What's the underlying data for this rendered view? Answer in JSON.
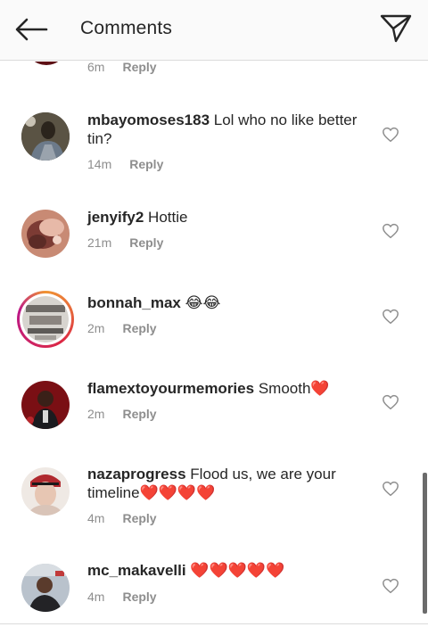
{
  "header": {
    "title": "Comments"
  },
  "partial_comment": {
    "time": "6m",
    "reply": "Reply"
  },
  "comments": [
    {
      "username": "mbayomoses183",
      "text": "Lol who no like better tin?",
      "time": "14m",
      "reply": "Reply"
    },
    {
      "username": "jenyify2",
      "text": "Hottie",
      "time": "21m",
      "reply": "Reply"
    },
    {
      "username": "bonnah_max",
      "text": "😂😂",
      "time": "2m",
      "reply": "Reply"
    },
    {
      "username": "flamextoyourmemories",
      "text": "Smooth❤️",
      "time": "2m",
      "reply": "Reply"
    },
    {
      "username": "nazaprogress",
      "text": "Flood us, we are your timeline❤️❤️❤️❤️",
      "time": "4m",
      "reply": "Reply"
    },
    {
      "username": "mc_makavelli",
      "text": "❤️❤️❤️❤️❤️",
      "time": "4m",
      "reply": "Reply"
    }
  ],
  "icons": {
    "back": "back-arrow-icon",
    "send": "send-icon",
    "like": "heart-outline-icon"
  },
  "colors": {
    "text": "#262626",
    "meta": "#8e8e8e",
    "header_bg": "#fafafa"
  }
}
